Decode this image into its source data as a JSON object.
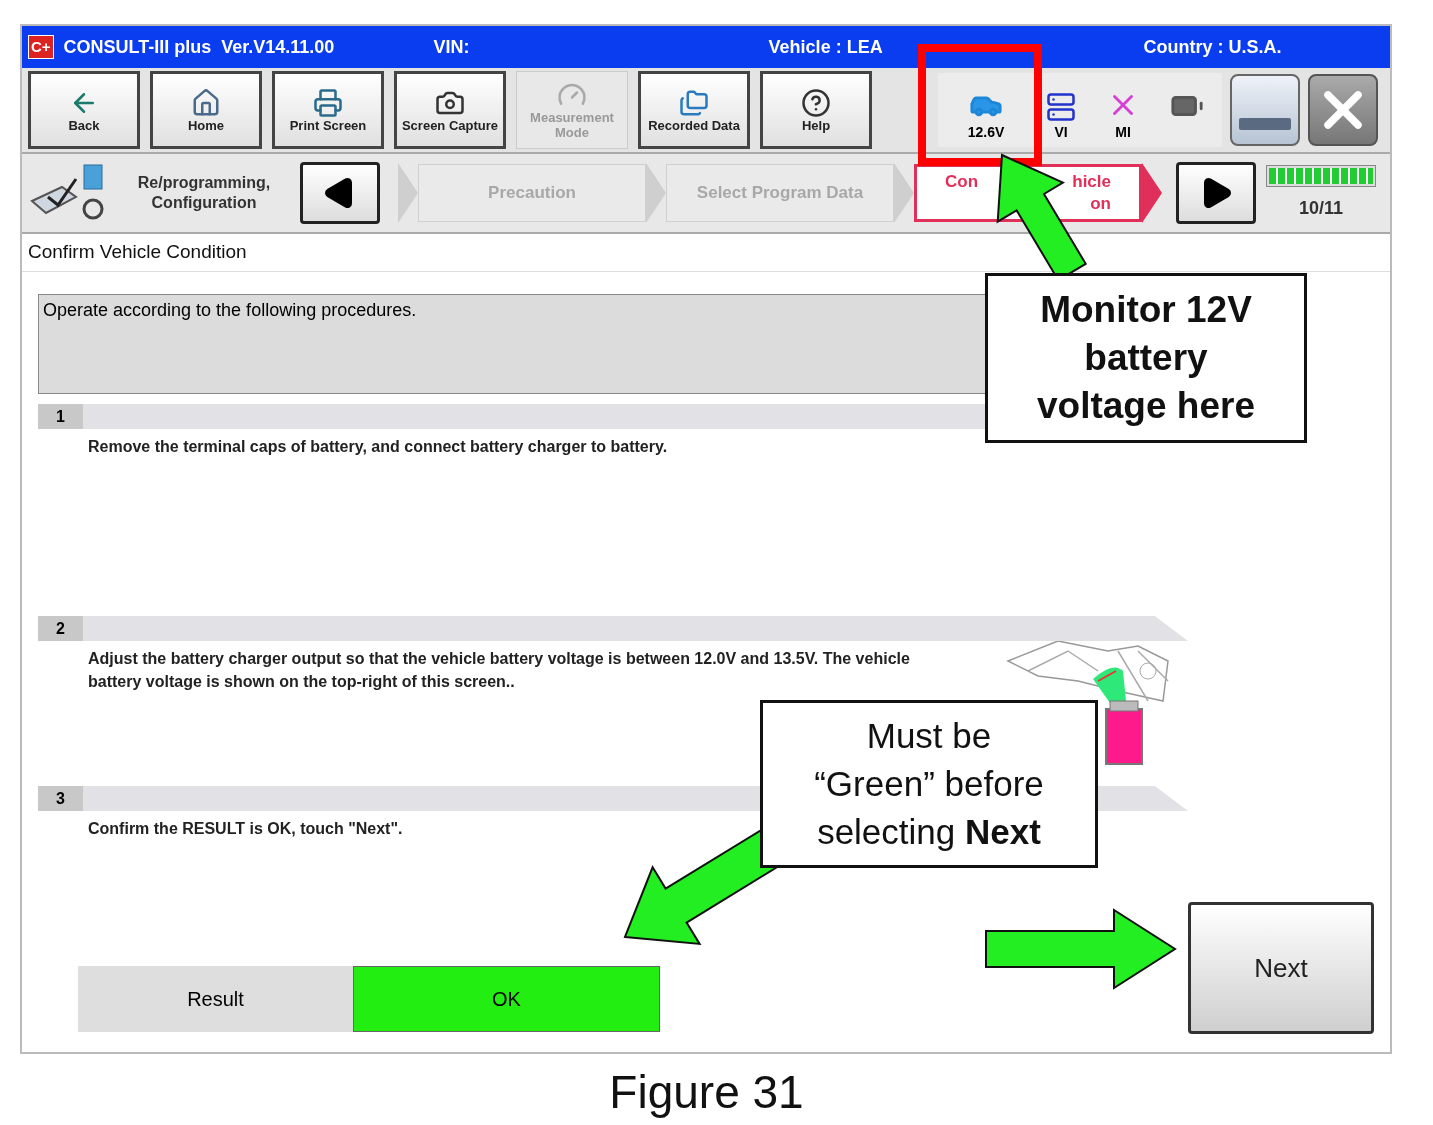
{
  "window": {
    "logo": "C+",
    "title": "CONSULT-III plus  Ver.V14.11.00",
    "vin_label": "VIN:",
    "vehicle": "Vehicle : LEA",
    "country": "Country : U.S.A."
  },
  "toolbar": [
    {
      "kind": "back",
      "label": "Back",
      "disabled": false
    },
    {
      "kind": "home",
      "label": "Home",
      "disabled": false
    },
    {
      "kind": "print",
      "label": "Print Screen",
      "disabled": false
    },
    {
      "kind": "camera",
      "label": "Screen Capture",
      "disabled": false
    },
    {
      "kind": "measure",
      "label": "Measurement Mode",
      "disabled": true
    },
    {
      "kind": "recorded",
      "label": "Recorded Data",
      "disabled": false
    },
    {
      "kind": "help",
      "label": "Help",
      "disabled": false
    }
  ],
  "status": [
    {
      "kind": "car",
      "label": "12.6V"
    },
    {
      "kind": "vi",
      "label": "VI"
    },
    {
      "kind": "mi",
      "label": "MI"
    },
    {
      "kind": "battery"
    }
  ],
  "breadcrumb": {
    "section": [
      "Re/programming,",
      "Configuration"
    ],
    "steps": [
      {
        "lines": [
          [
            "Precaution"
          ]
        ],
        "selected": false
      },
      {
        "lines": [
          [
            "Select Program Data"
          ]
        ],
        "selected": false
      },
      {
        "lines": [
          [
            "Con",
            "hicle"
          ],
          [
            "on"
          ]
        ],
        "selected": true
      }
    ],
    "progress": {
      "level": 1.0,
      "label": "10/11"
    }
  },
  "page_title": "Confirm Vehicle Condition",
  "instruction": "Operate according to the following procedures.",
  "steps": [
    {
      "number": "1",
      "text": "Remove the terminal caps of battery, and connect battery charger to battery."
    },
    {
      "number": "2",
      "text": "Adjust the battery charger output so that the vehicle battery voltage is between 12.0V and 13.5V. The vehicle battery voltage is shown on the top-right of this screen..",
      "picture": true
    },
    {
      "number": "3",
      "text": "Confirm the RESULT is OK, touch \"Next\"."
    }
  ],
  "result": {
    "label": "Result",
    "value": "OK",
    "ok": true
  },
  "next_button": "Next",
  "annotations": [
    {
      "text": "Monitor 12V battery voltage here"
    },
    {
      "text": "Must be “Green” before selecting **Next**"
    }
  ],
  "caption": "Figure 31"
}
